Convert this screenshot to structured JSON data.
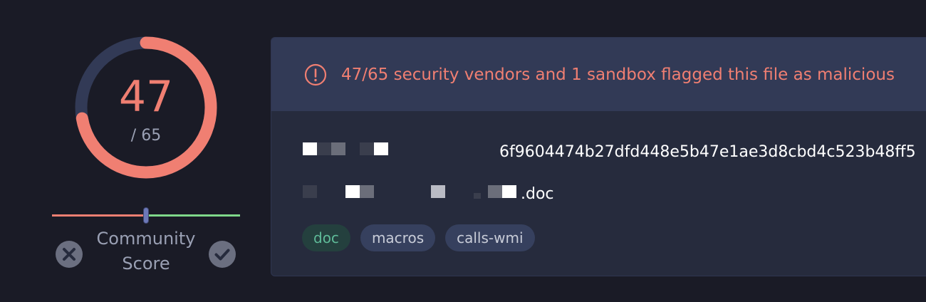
{
  "detection": {
    "positives": "47",
    "total": "/ 65",
    "positives_count": 47,
    "total_count": 65,
    "colors": {
      "malicious": "#f07f72",
      "track": "#323a56"
    }
  },
  "community": {
    "label_line1": "Community",
    "label_line2": "Score",
    "score_fraction": 0.5,
    "colors": {
      "negative": "#f07f72",
      "positive": "#7fd88a",
      "handle": "#6c78b8"
    },
    "downvote_icon": "close-icon",
    "upvote_icon": "check-icon"
  },
  "alert": {
    "icon": "exclamation-circle-icon",
    "text": "47/65 security vendors and 1 sandbox flagged this file as malicious"
  },
  "file": {
    "hash_visible": "6f9604474b27dfd448e5b47e1ae3d8cbd4c523b48ff5",
    "filename_visible": ".doc"
  },
  "tags": [
    {
      "label": "doc"
    },
    {
      "label": "macros"
    },
    {
      "label": "calls-wmi"
    }
  ]
}
